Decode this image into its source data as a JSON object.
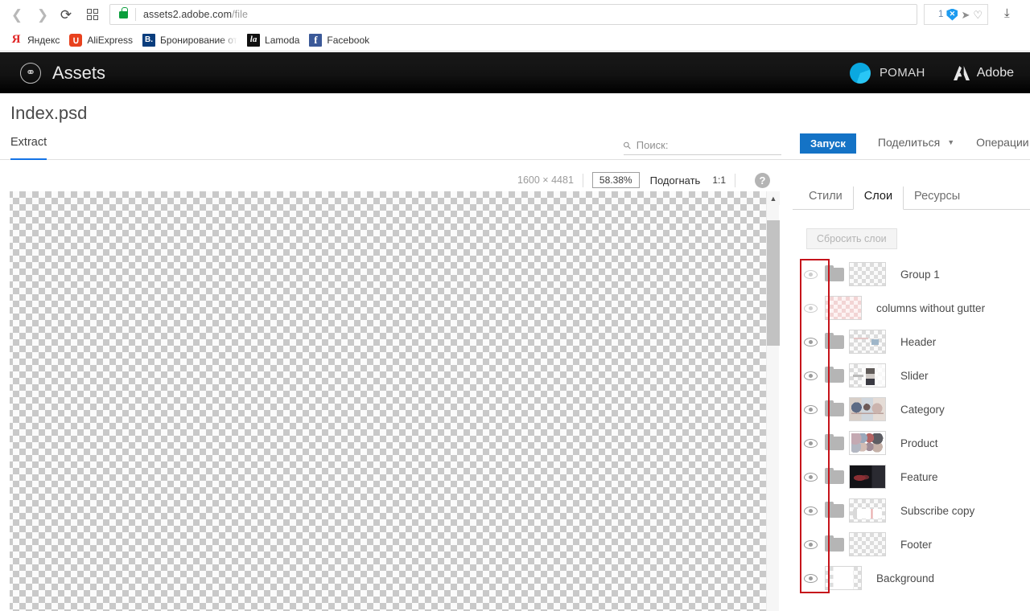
{
  "browser": {
    "back_icon": "chevron-left",
    "forward_icon": "chevron-right",
    "reload_icon": "reload",
    "apps_icon": "grid",
    "lock_icon": "padlock-secure",
    "url_host": "assets2.adobe.com",
    "url_path": "/file",
    "blocker_count": "1",
    "shield_glyph": "✕",
    "send_glyph": "➤",
    "heart_glyph": "♡",
    "download_glyph": "⤓"
  },
  "bookmarks": [
    {
      "label": "Яндекс",
      "glyph": "Я",
      "cls": "ico-yandex"
    },
    {
      "label": "AliExpress",
      "glyph": "∪",
      "cls": "ico-ali"
    },
    {
      "label": "Бронирование отелей",
      "glyph": "B.",
      "cls": "ico-booking"
    },
    {
      "label": "Lamoda",
      "glyph": "la",
      "cls": "ico-lamoda"
    },
    {
      "label": "Facebook",
      "glyph": "f",
      "cls": "ico-fb"
    }
  ],
  "app_header": {
    "logo_icon": "creative-cloud-logo",
    "title": "Assets",
    "user_name": "РОМАН",
    "brand": "Adobe",
    "brand_icon": "adobe-logo"
  },
  "file": {
    "name": "Index.psd",
    "tab_extract": "Extract"
  },
  "toolbar": {
    "search_placeholder": "Поиск:",
    "search_value": "",
    "run_label": "Запуск",
    "share_label": "Поделиться",
    "operations_label": "Операции",
    "accent_color": "#1473c6"
  },
  "canvas_bar": {
    "dimensions": "1600 × 4481",
    "zoom_level": "58.38%",
    "fit_label": "Подогнать",
    "ratio_label": "1:1",
    "help_glyph": "?"
  },
  "panel": {
    "tabs": [
      {
        "label": "Стили",
        "active": false
      },
      {
        "label": "Слои",
        "active": true
      },
      {
        "label": "Ресурсы",
        "active": false
      }
    ],
    "reset_label": "Сбросить слои",
    "highlight_color": "#c6141b",
    "layers": [
      {
        "label": "Group 1",
        "visible": false,
        "folder": true,
        "art": "art-plain",
        "pink": false
      },
      {
        "label": "columns without gutter",
        "visible": false,
        "folder": false,
        "art": "art-plain",
        "pink": true
      },
      {
        "label": "Header",
        "visible": true,
        "folder": true,
        "art": "art-header",
        "pink": false
      },
      {
        "label": "Slider",
        "visible": true,
        "folder": true,
        "art": "art-slider",
        "pink": false
      },
      {
        "label": "Category",
        "visible": true,
        "folder": true,
        "art": "art-category",
        "pink": false
      },
      {
        "label": "Product",
        "visible": true,
        "folder": true,
        "art": "art-product",
        "pink": false
      },
      {
        "label": "Feature",
        "visible": true,
        "folder": true,
        "art": "art-feature",
        "pink": false
      },
      {
        "label": "Subscribe copy",
        "visible": true,
        "folder": true,
        "art": "art-subscribe",
        "pink": false
      },
      {
        "label": "Footer",
        "visible": true,
        "folder": true,
        "art": "art-plain",
        "pink": false
      },
      {
        "label": "Background",
        "visible": true,
        "folder": false,
        "art": "art-background",
        "pink": false
      }
    ]
  },
  "scrollbar": {
    "up_glyph": "▲"
  }
}
